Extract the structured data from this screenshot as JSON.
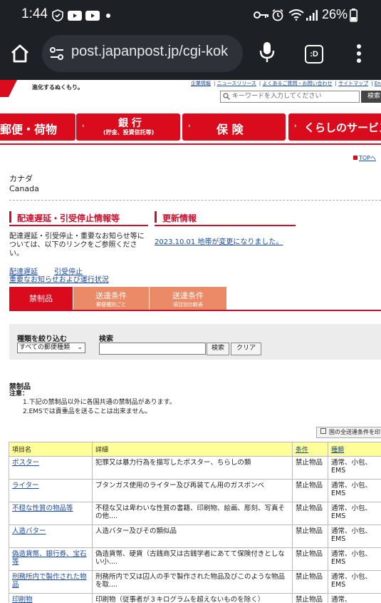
{
  "status": {
    "time": "1:44",
    "battery": "26%"
  },
  "browser": {
    "url": "post.japanpost.jp/cgi-kok",
    "tab_label": ":D"
  },
  "header": {
    "slogan": "進化するぬくもり。",
    "top_links": [
      "企業情報",
      "ニュースリリース",
      "よくあるご質問・お問い合わせ",
      "サイトマップ",
      "Eng"
    ],
    "search_placeholder": "キーワードを入力してください",
    "search_button": "検索"
  },
  "nav": [
    {
      "label": "郵便・荷物",
      "sub": ""
    },
    {
      "label": "銀 行",
      "sub": "(貯金、投資信託等)"
    },
    {
      "label": "保 険",
      "sub": ""
    },
    {
      "label": "くらしのサービス",
      "sub": ""
    }
  ],
  "top_link": "TOPへ",
  "country": {
    "ja": "カナダ",
    "en": "Canada"
  },
  "delay": {
    "heading": "配達遅延・引受停止情報等",
    "description": "配達遅延・引受停止・重要なお知らせ等については、以下のリンクをご参照ください。",
    "links": [
      "配達遅延",
      "引受停止",
      "重要なお知らせおよび運行状況"
    ]
  },
  "updates": {
    "heading": "更新情報",
    "item": "2023.10.01 地帯が変更になりました。"
  },
  "tabs": [
    {
      "label": "禁制品",
      "sub": ""
    },
    {
      "label": "送達条件",
      "sub": "郵便種別ごと"
    },
    {
      "label": "送達条件",
      "sub": "項目別比較表"
    }
  ],
  "filter": {
    "type_label": "種類を絞り込む",
    "type_value": "すべての郵便種類",
    "search_label": "検索",
    "search_button": "検索",
    "clear_button": "クリア"
  },
  "prohibited": {
    "title": "禁制品",
    "note_label": "注意：",
    "notes": [
      "1.下記の禁制品以外に各国共通の禁制品があります。",
      "2.EMSでは貴重品を送ることは出来ません。"
    ]
  },
  "print_button": "国の全送達条件を印",
  "table": {
    "headers": [
      "項目名",
      "詳細",
      "条件",
      "種類"
    ],
    "rows": [
      {
        "name": "ポスター",
        "detail": "犯罪又は暴力行為を描写したポスター、ちらしの類",
        "cond": "禁止物品",
        "kind": "通常、小包、EMS"
      },
      {
        "name": "ライター",
        "detail": "ブタンガス使用のライター及び再装てん用のガスボンベ",
        "cond": "禁止物品",
        "kind": "通常、小包、EMS"
      },
      {
        "name": "不穏な性質の物品等",
        "detail": "不穏な又は卑わいな性質の書籍、印刷物、絵画、彫刻、写真その他....",
        "cond": "禁止物品",
        "kind": "通常、小包、EMS"
      },
      {
        "name": "人造バター",
        "detail": "人造バター及びその類似品",
        "cond": "禁止物品",
        "kind": "通常、小包、EMS"
      },
      {
        "name": "偽造貨幣、銀行券、宝石等",
        "detail": "偽造貨幣、硬貨（古銭商又は古銭学者にあてて保険付きとしない小....",
        "cond": "禁止物品",
        "kind": "通常、小包、EMS"
      },
      {
        "name": "刑務所内で製作された物品",
        "detail": "刑務所内で又は囚人の手で製作された物品及びこのような物品を取....",
        "cond": "禁止物品",
        "kind": "通常、小包、EMS"
      },
      {
        "name": "印刷物",
        "detail": "印刷物（従事者が３キログラムを超えないものを除く）",
        "cond": "禁止物品",
        "kind": "通常、"
      }
    ]
  },
  "colors": {
    "brand_red": "#d90b1c",
    "tab_inactive": "#ea8a66",
    "table_header": "#ffff99"
  }
}
